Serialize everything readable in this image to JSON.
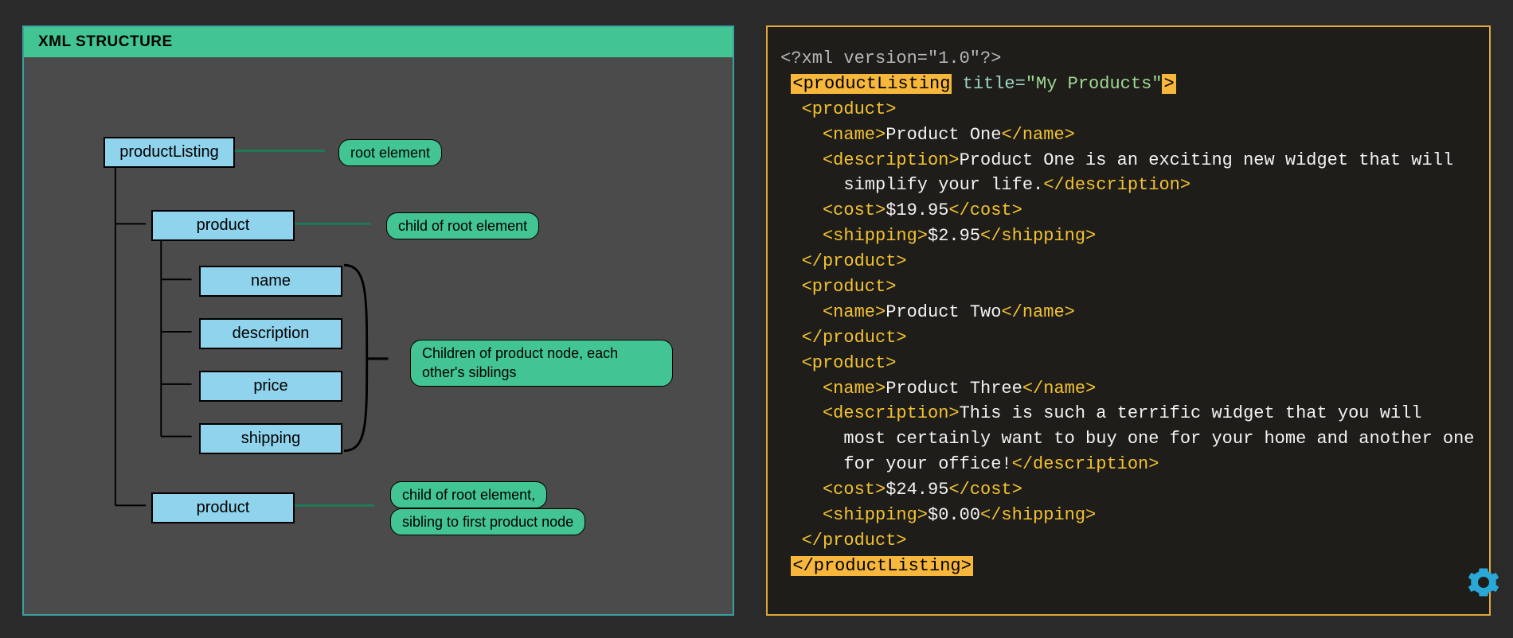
{
  "left": {
    "title": "XML STRUCTURE",
    "nodes": {
      "root": "productListing",
      "product1": "product",
      "name": "name",
      "description": "description",
      "price": "price",
      "shipping": "shipping",
      "product2": "product"
    },
    "annotations": {
      "root": "root element",
      "product1": "child of root element",
      "children": "Children of product node, each other's siblings",
      "product2a": "child of root element,",
      "product2b": "sibling to first product node"
    }
  },
  "xml": {
    "decl": "<?xml version=\"1.0\"?>",
    "root_open": "<productListing",
    "root_attr_name": " title=",
    "root_attr_val": "\"My Products\"",
    "root_open_end": ">",
    "root_close": "</productListing>",
    "prod_open": "  <product>",
    "prod_close": "  </product>",
    "p1_name_o": "    <name>",
    "p1_name_t": "Product One",
    "p1_name_c": "</name>",
    "p1_desc_o": "    <description>",
    "p1_desc_t1": "Product One is an exciting new widget that will",
    "p1_desc_t2": "      simplify your life.",
    "p1_desc_c": "</description>",
    "p1_cost_o": "    <cost>",
    "p1_cost_t": "$19.95",
    "p1_cost_c": "</cost>",
    "p1_ship_o": "    <shipping>",
    "p1_ship_t": "$2.95",
    "p1_ship_c": "</shipping>",
    "p2_name_o": "    <name>",
    "p2_name_t": "Product Two",
    "p2_name_c": "</name>",
    "p3_name_o": "    <name>",
    "p3_name_t": "Product Three",
    "p3_name_c": "</name>",
    "p3_desc_o": "    <description>",
    "p3_desc_t1": "This is such a terrific widget that you will",
    "p3_desc_t2": "      most certainly want to buy one for your home and another one",
    "p3_desc_t3": "      for your office!",
    "p3_desc_c": "</description>",
    "p3_cost_o": "    <cost>",
    "p3_cost_t": "$24.95",
    "p3_cost_c": "</cost>",
    "p3_ship_o": "    <shipping>",
    "p3_ship_t": "$0.00",
    "p3_ship_c": "</shipping>"
  },
  "colors": {
    "panel_bg": "#4b4b4b",
    "accent_green": "#42c592",
    "node_blue": "#8fd3ec",
    "code_bg": "#1f1d1a",
    "code_border": "#e2a63b",
    "highlight": "#f6b73c"
  }
}
